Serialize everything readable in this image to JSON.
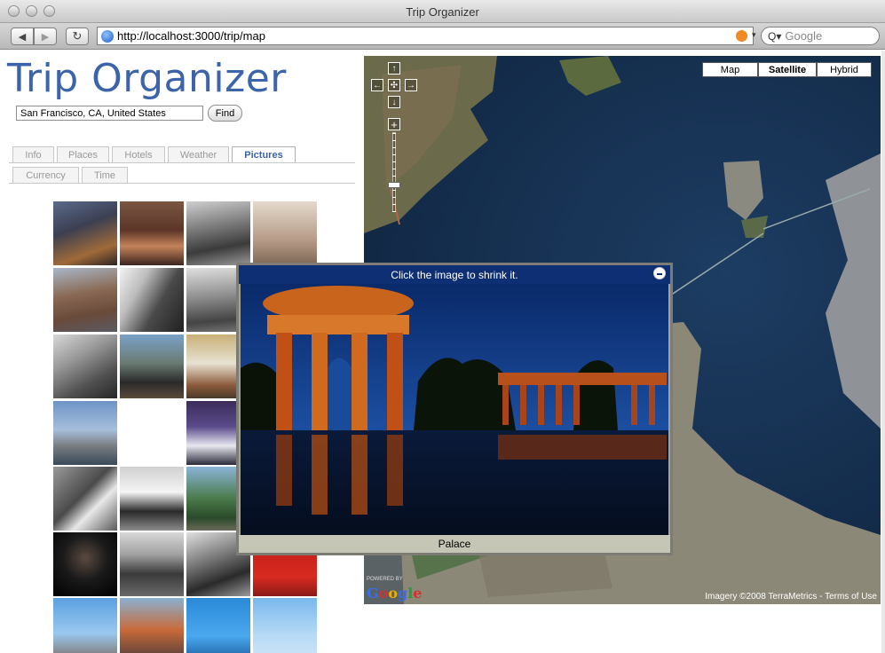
{
  "window": {
    "title": "Trip Organizer"
  },
  "browser": {
    "url": "http://localhost:3000/trip/map",
    "search_placeholder": "Google"
  },
  "app": {
    "title": "Trip Organizer",
    "location_value": "San Francisco, CA, United States",
    "find_label": "Find",
    "tabs_row1": [
      "Info",
      "Places",
      "Hotels",
      "Weather",
      "Pictures"
    ],
    "tabs_row2": [
      "Currency",
      "Time"
    ],
    "active_tab": "Pictures"
  },
  "map": {
    "types": [
      "Map",
      "Satellite",
      "Hybrid"
    ],
    "active_type": "Satellite",
    "copyright": "Imagery ©2008 TerraMetrics - Terms of Use",
    "powered_by": "POWERED BY",
    "logo": "Google"
  },
  "popup": {
    "header": "Click the image to shrink it.",
    "caption": "Palace"
  }
}
